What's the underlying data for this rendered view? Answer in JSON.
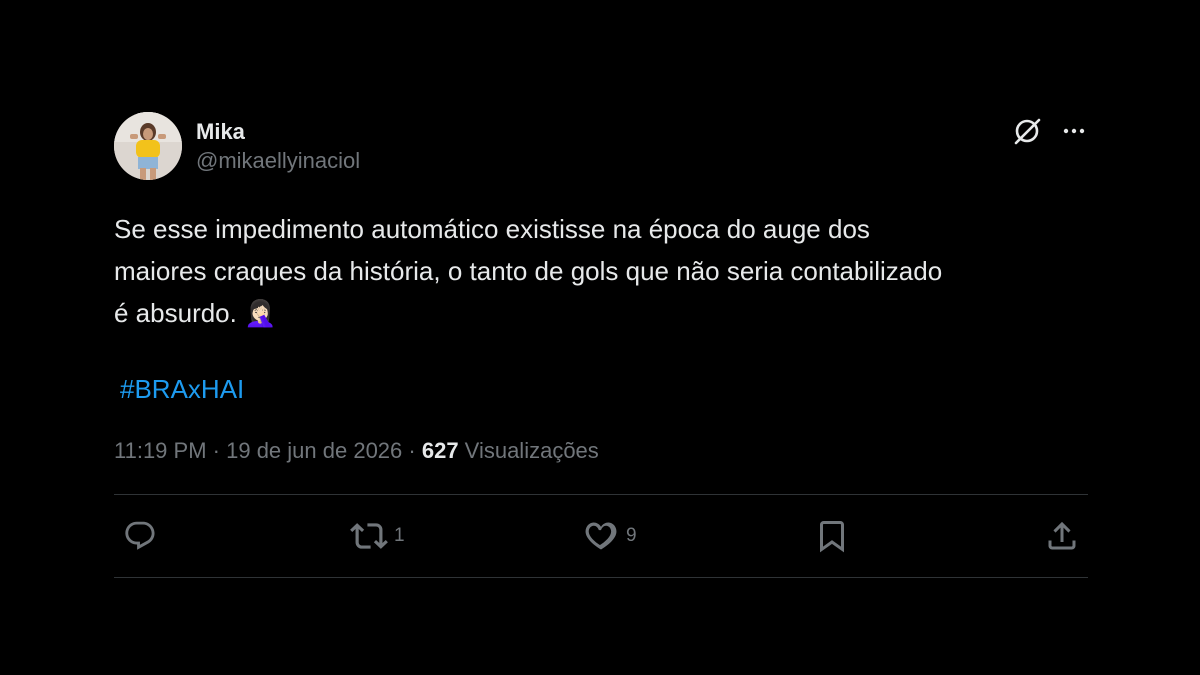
{
  "user": {
    "display_name": "Mika",
    "handle": "@mikaellyinaciol",
    "avatar": "profile-photo"
  },
  "header_icons": {
    "grok": "grok-icon",
    "more": "more-icon"
  },
  "tweet": {
    "text": "Se esse impedimento automático existisse na época do auge dos\nmaiores craques da história, o tanto de gols que não seria contabilizado\né absurdo. 🤦🏻‍♀️",
    "hashtag": "#BRAxHAI"
  },
  "meta": {
    "time": "11:19 PM",
    "separator1": " · ",
    "date": "19 de jun de 2026",
    "separator2": " · ",
    "views_count": "627",
    "views_label": " Visualizações"
  },
  "actions": {
    "reply": {
      "icon": "reply-icon",
      "count": ""
    },
    "retweet": {
      "icon": "retweet-icon",
      "count": "1"
    },
    "like": {
      "icon": "heart-icon",
      "count": "9"
    },
    "bookmark": {
      "icon": "bookmark-icon",
      "count": ""
    },
    "share": {
      "icon": "share-icon",
      "count": ""
    }
  },
  "colors": {
    "background": "#000000",
    "text": "#e7e9ea",
    "secondary": "#71767b",
    "link": "#1d9bf0",
    "divider": "#2f3336"
  }
}
